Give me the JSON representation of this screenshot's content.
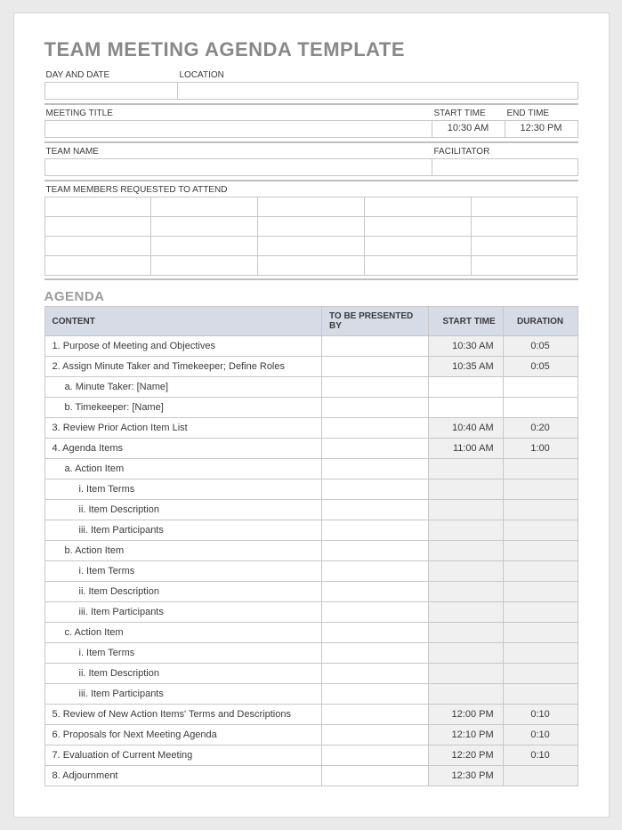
{
  "title": "TEAM MEETING AGENDA TEMPLATE",
  "fields": {
    "day_date_label": "DAY AND DATE",
    "day_date_value": "",
    "location_label": "LOCATION",
    "location_value": "",
    "meeting_title_label": "MEETING TITLE",
    "meeting_title_value": "",
    "start_time_label": "START TIME",
    "start_time_value": "10:30 AM",
    "end_time_label": "END TIME",
    "end_time_value": "12:30 PM",
    "team_name_label": "TEAM NAME",
    "team_name_value": "",
    "facilitator_label": "FACILITATOR",
    "facilitator_value": "",
    "attend_label": "TEAM MEMBERS REQUESTED TO ATTEND"
  },
  "agenda_section": "AGENDA",
  "agenda_headers": {
    "content": "CONTENT",
    "presented_by": "TO BE PRESENTED BY",
    "start_time": "START TIME",
    "duration": "DURATION"
  },
  "agenda_rows": [
    {
      "c": "1. Purpose of Meeting and Objectives",
      "p": "",
      "s": "10:30 AM",
      "d": "0:05",
      "indent": 0,
      "shade": true
    },
    {
      "c": "2. Assign Minute Taker and Timekeeper; Define Roles",
      "p": "",
      "s": "10:35 AM",
      "d": "0:05",
      "indent": 0,
      "shade": true
    },
    {
      "c": "a. Minute Taker: [Name]",
      "p": "",
      "s": "",
      "d": "",
      "indent": 1,
      "shade": false
    },
    {
      "c": "b. Timekeeper: [Name]",
      "p": "",
      "s": "",
      "d": "",
      "indent": 1,
      "shade": false
    },
    {
      "c": "3. Review Prior Action Item List",
      "p": "",
      "s": "10:40 AM",
      "d": "0:20",
      "indent": 0,
      "shade": true
    },
    {
      "c": "4. Agenda Items",
      "p": "",
      "s": "11:00 AM",
      "d": "1:00",
      "indent": 0,
      "shade": true
    },
    {
      "c": "a. Action Item",
      "p": "",
      "s": "",
      "d": "",
      "indent": 1,
      "shade": true
    },
    {
      "c": "i. Item Terms",
      "p": "",
      "s": "",
      "d": "",
      "indent": 2,
      "shade": true
    },
    {
      "c": "ii. Item Description",
      "p": "",
      "s": "",
      "d": "",
      "indent": 2,
      "shade": true
    },
    {
      "c": "iii. Item Participants",
      "p": "",
      "s": "",
      "d": "",
      "indent": 2,
      "shade": true
    },
    {
      "c": "b. Action Item",
      "p": "",
      "s": "",
      "d": "",
      "indent": 1,
      "shade": true
    },
    {
      "c": "i. Item Terms",
      "p": "",
      "s": "",
      "d": "",
      "indent": 2,
      "shade": true
    },
    {
      "c": "ii. Item Description",
      "p": "",
      "s": "",
      "d": "",
      "indent": 2,
      "shade": true
    },
    {
      "c": "iii. Item Participants",
      "p": "",
      "s": "",
      "d": "",
      "indent": 2,
      "shade": true
    },
    {
      "c": "c. Action Item",
      "p": "",
      "s": "",
      "d": "",
      "indent": 1,
      "shade": true
    },
    {
      "c": "i. Item Terms",
      "p": "",
      "s": "",
      "d": "",
      "indent": 2,
      "shade": true
    },
    {
      "c": "ii. Item Description",
      "p": "",
      "s": "",
      "d": "",
      "indent": 2,
      "shade": true
    },
    {
      "c": "iii. Item Participants",
      "p": "",
      "s": "",
      "d": "",
      "indent": 2,
      "shade": true
    },
    {
      "c": "5. Review of New Action Items' Terms and Descriptions",
      "p": "",
      "s": "12:00 PM",
      "d": "0:10",
      "indent": 0,
      "shade": true
    },
    {
      "c": "6. Proposals for Next Meeting Agenda",
      "p": "",
      "s": "12:10 PM",
      "d": "0:10",
      "indent": 0,
      "shade": true
    },
    {
      "c": "7. Evaluation of Current Meeting",
      "p": "",
      "s": "12:20 PM",
      "d": "0:10",
      "indent": 0,
      "shade": true
    },
    {
      "c": "8. Adjournment",
      "p": "",
      "s": "12:30 PM",
      "d": "",
      "indent": 0,
      "shade": true
    }
  ]
}
